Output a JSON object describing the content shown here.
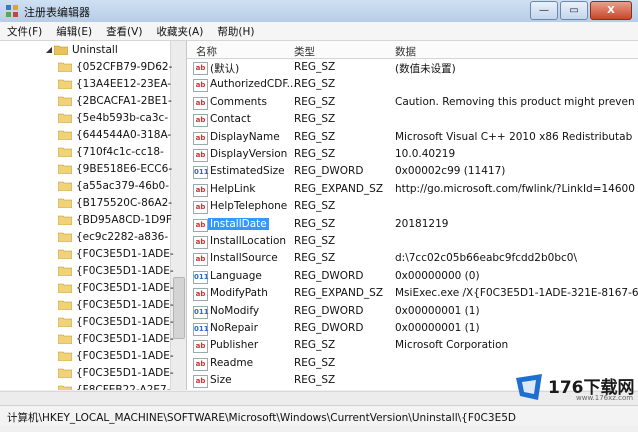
{
  "window": {
    "title": "注册表编辑器",
    "controls": [
      "—",
      "▭",
      "X"
    ]
  },
  "menu": [
    "文件(F)",
    "编辑(E)",
    "查看(V)",
    "收藏夹(A)",
    "帮助(H)"
  ],
  "tree": {
    "root": "Uninstall",
    "items": [
      "{052CFB79-9D62-",
      "{13A4EE12-23EA-",
      "{2BCACFA1-2BE1-",
      "{5e4b593b-ca3c-",
      "{644544A0-318A-",
      "{710f4c1c-cc18-",
      "{9BE518E6-ECC6-",
      "{a55ac379-46b0-",
      "{B175520C-86A2-",
      "{BD95A8CD-1D9F",
      "{ec9c2282-a836-",
      "{F0C3E5D1-1ADE-",
      "{F0C3E5D1-1ADE-",
      "{F0C3E5D1-1ADE-",
      "{F0C3E5D1-1ADE-",
      "{F0C3E5D1-1ADE-",
      "{F0C3E5D1-1ADE-",
      "{F0C3E5D1-1ADE-",
      "{F0C3E5D1-1ADE-",
      "{F8CFEB22-A2E7-"
    ]
  },
  "list": {
    "columns": [
      "名称",
      "类型",
      "数据"
    ],
    "rows": [
      {
        "name": "(默认)",
        "type": "REG_SZ",
        "data": "(数值未设置)",
        "icon": "string"
      },
      {
        "name": "AuthorizedCDF...",
        "type": "REG_SZ",
        "data": "",
        "icon": "string"
      },
      {
        "name": "Comments",
        "type": "REG_SZ",
        "data": "Caution. Removing this product might preven",
        "icon": "string"
      },
      {
        "name": "Contact",
        "type": "REG_SZ",
        "data": "",
        "icon": "string"
      },
      {
        "name": "DisplayName",
        "type": "REG_SZ",
        "data": "Microsoft Visual C++ 2010  x86 Redistributab",
        "icon": "string"
      },
      {
        "name": "DisplayVersion",
        "type": "REG_SZ",
        "data": "10.0.40219",
        "icon": "string"
      },
      {
        "name": "EstimatedSize",
        "type": "REG_DWORD",
        "data": "0x00002c99 (11417)",
        "icon": "binary"
      },
      {
        "name": "HelpLink",
        "type": "REG_EXPAND_SZ",
        "data": "http://go.microsoft.com/fwlink/?LinkId=14600",
        "icon": "string"
      },
      {
        "name": "HelpTelephone",
        "type": "REG_SZ",
        "data": "",
        "icon": "string"
      },
      {
        "name": "InstallDate",
        "type": "REG_SZ",
        "data": "20181219",
        "icon": "string",
        "selected": true
      },
      {
        "name": "InstallLocation",
        "type": "REG_SZ",
        "data": "",
        "icon": "string"
      },
      {
        "name": "InstallSource",
        "type": "REG_SZ",
        "data": "d:\\7cc02c05b66eabc9fcdd2b0bc0\\",
        "icon": "string"
      },
      {
        "name": "Language",
        "type": "REG_DWORD",
        "data": "0x00000000 (0)",
        "icon": "binary"
      },
      {
        "name": "ModifyPath",
        "type": "REG_EXPAND_SZ",
        "data": "MsiExec.exe /X{F0C3E5D1-1ADE-321E-8167-6.",
        "icon": "string"
      },
      {
        "name": "NoModify",
        "type": "REG_DWORD",
        "data": "0x00000001 (1)",
        "icon": "binary"
      },
      {
        "name": "NoRepair",
        "type": "REG_DWORD",
        "data": "0x00000001 (1)",
        "icon": "binary"
      },
      {
        "name": "Publisher",
        "type": "REG_SZ",
        "data": "Microsoft Corporation",
        "icon": "string"
      },
      {
        "name": "Readme",
        "type": "REG_SZ",
        "data": "",
        "icon": "string"
      },
      {
        "name": "Size",
        "type": "REG_SZ",
        "data": "",
        "icon": "string"
      }
    ]
  },
  "status": {
    "path": "计算机\\HKEY_LOCAL_MACHINE\\SOFTWARE\\Microsoft\\Windows\\CurrentVersion\\Uninstall\\{F0C3E5D"
  },
  "watermark": {
    "text": "176下载网",
    "sub": "www.176xz.com"
  }
}
